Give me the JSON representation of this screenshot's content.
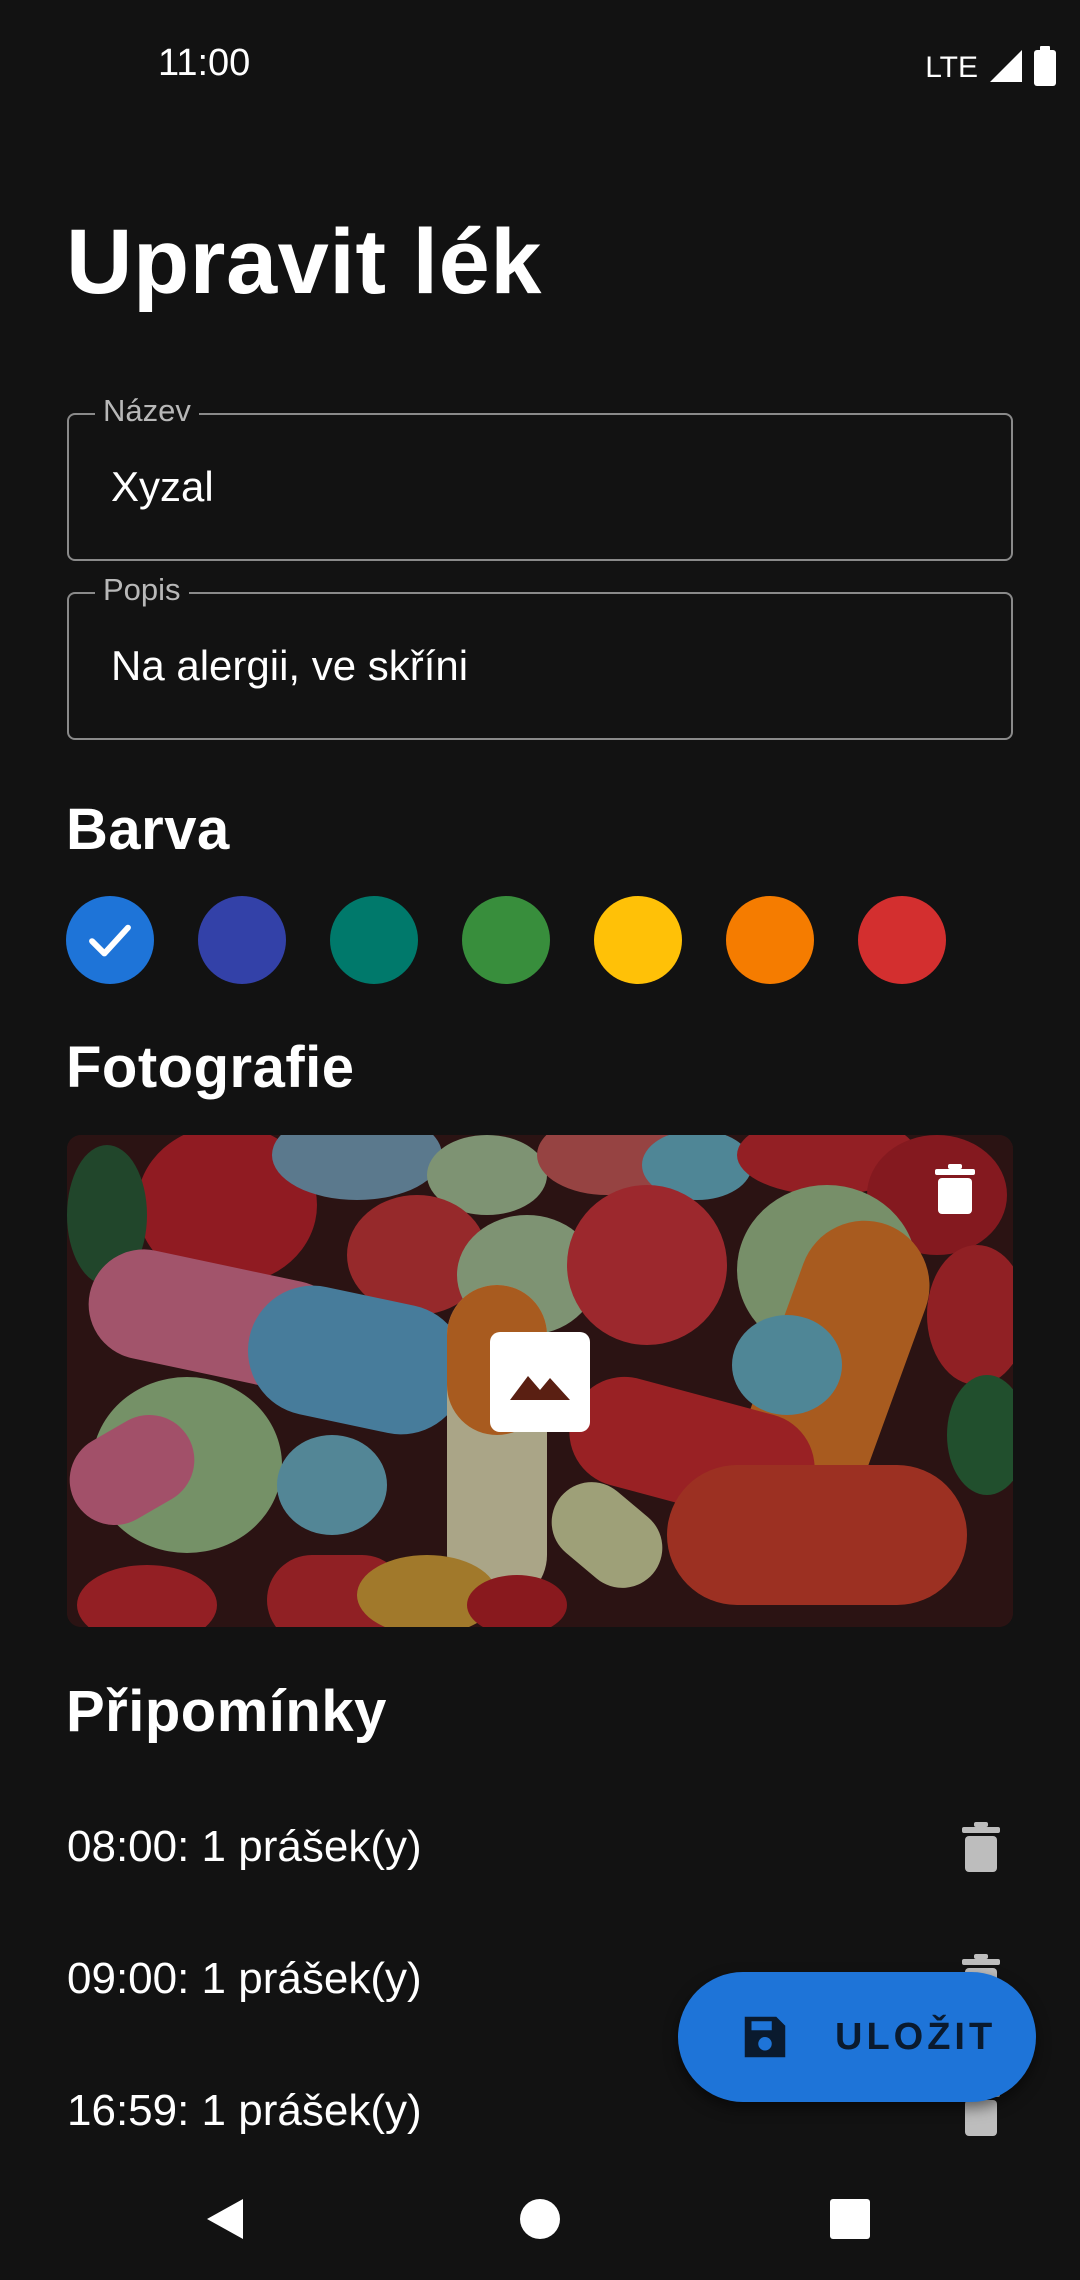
{
  "status_bar": {
    "time": "11:00",
    "network": "LTE"
  },
  "page": {
    "title": "Upravit lék"
  },
  "fields": {
    "name": {
      "label": "Název",
      "value": "Xyzal"
    },
    "description": {
      "label": "Popis",
      "value": "Na alergii, ve skříni"
    }
  },
  "color_section": {
    "heading": "Barva",
    "selected_index": 0,
    "options": [
      "#1e74d8",
      "#3341a8",
      "#00796b",
      "#388e3c",
      "#ffc107",
      "#f57c00",
      "#d32f2f"
    ]
  },
  "photo_section": {
    "heading": "Fotografie",
    "delete_icon": "trash-icon",
    "pick_icon": "image-icon"
  },
  "reminders_section": {
    "heading": "Připomínky",
    "items": [
      {
        "text": "08:00: 1 prášek(y)"
      },
      {
        "text": "09:00: 1 prášek(y)"
      },
      {
        "text": "16:59: 1 prášek(y)"
      }
    ]
  },
  "fab": {
    "label": "ULOŽIT",
    "icon": "save-icon"
  },
  "colors": {
    "background": "#121212",
    "accent": "#1e74d8",
    "outline": "#8a8a8a"
  }
}
